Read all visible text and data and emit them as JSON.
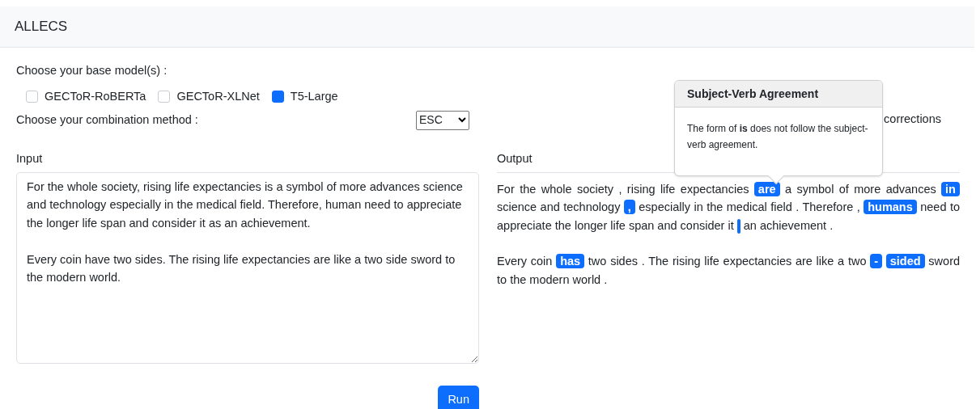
{
  "navbar": {
    "brand": "ALLECS"
  },
  "models": {
    "label": "Choose your base model(s) :",
    "options": [
      {
        "label": "GECToR-RoBERTa",
        "checked": false
      },
      {
        "label": "GECToR-XLNet",
        "checked": false
      },
      {
        "label": "T5-Large",
        "checked": true
      }
    ]
  },
  "combination": {
    "label": "Choose your combination method :",
    "value": "ESC"
  },
  "corrections_label": "corrections",
  "input": {
    "label": "Input",
    "value": "For the whole society, rising life expectancies is a symbol of more advances science and technology especially in the medical field. Therefore, human need to appreciate the longer life span and consider it as an achievement.\n\nEvery coin have two sides. The rising life expectancies are like a two side sword to the modern world."
  },
  "run_button": "Run",
  "output": {
    "label": "Output",
    "paragraphs": [
      [
        {
          "kind": "text",
          "text": "For the whole society , rising life expectancies"
        },
        {
          "kind": "correction",
          "text": "are"
        },
        {
          "kind": "text",
          "text": "a symbol of more advances"
        },
        {
          "kind": "correction",
          "text": "in"
        },
        {
          "kind": "text",
          "text": "science and technology"
        },
        {
          "kind": "correction",
          "text": ","
        },
        {
          "kind": "text",
          "text": "especially in the medical field . Therefore ,"
        },
        {
          "kind": "correction",
          "text": "humans"
        },
        {
          "kind": "text",
          "text": "need to appreciate the longer life span and consider it"
        },
        {
          "kind": "deletion"
        },
        {
          "kind": "text",
          "text": "an achievement ."
        }
      ],
      [
        {
          "kind": "text",
          "text": "Every coin"
        },
        {
          "kind": "correction",
          "text": "has"
        },
        {
          "kind": "text",
          "text": "two sides . The rising life expectancies are like a two"
        },
        {
          "kind": "correction",
          "text": "-"
        },
        {
          "kind": "correction",
          "text": "sided"
        },
        {
          "kind": "text",
          "text": "sword to the modern world ."
        }
      ]
    ]
  },
  "popover": {
    "title": "Subject-Verb Agreement",
    "body": "The form of **is** does not follow the subject-verb agreement."
  }
}
